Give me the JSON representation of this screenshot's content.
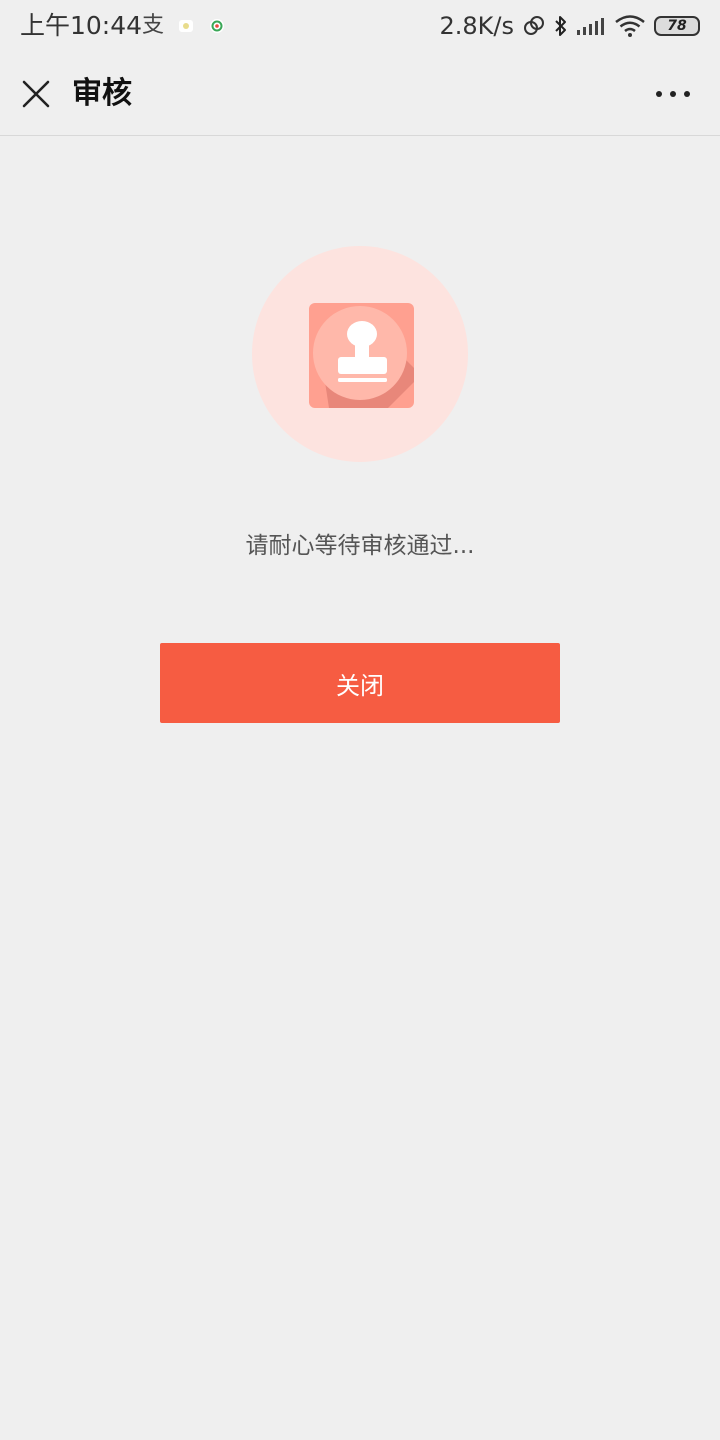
{
  "status_bar": {
    "time": "上午10:44",
    "net_speed": "2.8K/s",
    "battery": "78",
    "app_icons": [
      "alipay-icon",
      "app-notification-icon",
      "app-notification-icon-2"
    ]
  },
  "nav": {
    "title": "审核",
    "close_icon": "close-icon",
    "more_icon": "more-dots-icon"
  },
  "main": {
    "icon": "stamp-icon",
    "message": "请耐心等待审核通过...",
    "close_button_label": "关闭"
  },
  "colors": {
    "background": "#efefef",
    "accent": "#f65c42",
    "hero_circle": "#fde3df",
    "stamp_tile": "#ffa090"
  }
}
